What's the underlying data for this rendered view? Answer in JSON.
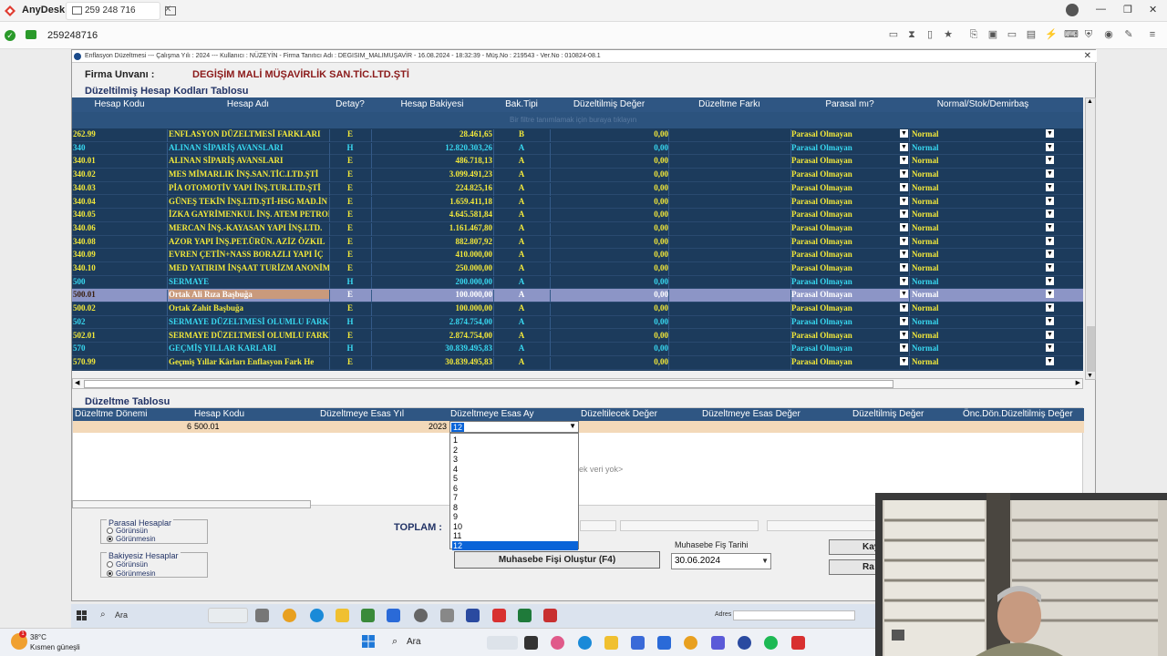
{
  "anydesk": {
    "app_name": "AnyDesk",
    "tab_label": "259 248 716",
    "session_id": "259248716",
    "window_controls": [
      "—",
      "❐",
      "✕"
    ]
  },
  "app": {
    "title": "Enflasyon Düzeltmesi  ---  Çalışma Yılı : 2024  ---  Kullanıcı : NÜZEYİN - Firma Tanıtıcı Adı : DEGISIM_MALIMUŞAVİR - 16.08.2024 - 18:32:39 - Müş.No : 219543 - Ver.No : 010824-08.1",
    "close": "✕",
    "firma_label": "Firma Unvanı :",
    "firma_value": "DEGİŞİM MALİ MÜŞAVİRLİK SAN.TİC.LTD.ŞTİ",
    "section1_title": "Düzeltilmiş Hesap Kodları Tablosu",
    "section2_title": "Düzeltme Tablosu"
  },
  "grid1": {
    "headers": [
      "Hesap Kodu",
      "Hesap Adı",
      "Detay?",
      "Hesap Bakiyesi",
      "Bak.Tipi",
      "Düzeltilmiş Değer",
      "Düzeltme Farkı",
      "Parasal mı?",
      "Normal/Stok/Demirbaş"
    ],
    "filter_hint": "Bir filtre tanımlamak için buraya tıklayın",
    "rows": [
      {
        "kod": "262.99",
        "ad": "ENFLASYON DÜZELTMESİ FARKLARI",
        "detay": "E",
        "bakiye": "28.461,65",
        "tip": "B",
        "duz": "0,00",
        "parasal": "Parasal Olmayan",
        "nsd": "Normal"
      },
      {
        "kod": "340",
        "ad": "ALINAN SİPARİŞ AVANSLARI",
        "detay": "H",
        "bakiye": "12.820.303,26",
        "tip": "A",
        "duz": "0,00",
        "parasal": "Parasal Olmayan",
        "nsd": "Normal"
      },
      {
        "kod": "340.01",
        "ad": "ALINAN SİPARİŞ AVANSLARI",
        "detay": "E",
        "bakiye": "486.718,13",
        "tip": "A",
        "duz": "0,00",
        "parasal": "Parasal Olmayan",
        "nsd": "Normal"
      },
      {
        "kod": "340.02",
        "ad": "MES MİMARLIK İNŞ.SAN.TİC.LTD.ŞTİ",
        "detay": "E",
        "bakiye": "3.099.491,23",
        "tip": "A",
        "duz": "0,00",
        "parasal": "Parasal Olmayan",
        "nsd": "Normal"
      },
      {
        "kod": "340.03",
        "ad": "PİA OTOMOTİV YAPI İNŞ.TUR.LTD.ŞTİ",
        "detay": "E",
        "bakiye": "224.825,16",
        "tip": "A",
        "duz": "0,00",
        "parasal": "Parasal Olmayan",
        "nsd": "Normal"
      },
      {
        "kod": "340.04",
        "ad": "GÜNEŞ TEKİN İNŞ.LTD.ŞTİ-HSG MAD.İN",
        "detay": "E",
        "bakiye": "1.659.411,18",
        "tip": "A",
        "duz": "0,00",
        "parasal": "Parasal Olmayan",
        "nsd": "Normal"
      },
      {
        "kod": "340.05",
        "ad": "İZKA GAYRİMENKUL İNŞ. ATEM PETROL",
        "detay": "E",
        "bakiye": "4.645.581,84",
        "tip": "A",
        "duz": "0,00",
        "parasal": "Parasal Olmayan",
        "nsd": "Normal"
      },
      {
        "kod": "340.06",
        "ad": "MERCAN İNŞ.-KAYASAN YAPI İNŞ.LTD.",
        "detay": "E",
        "bakiye": "1.161.467,80",
        "tip": "A",
        "duz": "0,00",
        "parasal": "Parasal Olmayan",
        "nsd": "Normal"
      },
      {
        "kod": "340.08",
        "ad": "AZOR YAPI İNŞ.PET.ÜRÜN. AZİZ ÖZKIL",
        "detay": "E",
        "bakiye": "882.807,92",
        "tip": "A",
        "duz": "0,00",
        "parasal": "Parasal Olmayan",
        "nsd": "Normal"
      },
      {
        "kod": "340.09",
        "ad": "EVREN ÇETİN+NASS BORAZLI YAPI İÇ",
        "detay": "E",
        "bakiye": "410.000,00",
        "tip": "A",
        "duz": "0,00",
        "parasal": "Parasal Olmayan",
        "nsd": "Normal"
      },
      {
        "kod": "340.10",
        "ad": "MED YATIRIM İNŞAAT TURİZM ANONİM",
        "detay": "E",
        "bakiye": "250.000,00",
        "tip": "A",
        "duz": "0,00",
        "parasal": "Parasal Olmayan",
        "nsd": "Normal"
      },
      {
        "kod": "500",
        "ad": "SERMAYE",
        "detay": "H",
        "bakiye": "200.000,00",
        "tip": "A",
        "duz": "0,00",
        "parasal": "Parasal Olmayan",
        "nsd": "Normal"
      },
      {
        "kod": "500.01",
        "ad": "Ortak Ali Rıza Başbuğa",
        "detay": "E",
        "bakiye": "100.000,00",
        "tip": "A",
        "duz": "0,00",
        "parasal": "Parasal Olmayan",
        "nsd": "Normal",
        "selected": true
      },
      {
        "kod": "500.02",
        "ad": "Ortak Zahit Başbuğa",
        "detay": "E",
        "bakiye": "100.000,00",
        "tip": "A",
        "duz": "0,00",
        "parasal": "Parasal Olmayan",
        "nsd": "Normal"
      },
      {
        "kod": "502",
        "ad": "SERMAYE DÜZELTMESİ OLUMLU FARKL",
        "detay": "H",
        "bakiye": "2.874.754,00",
        "tip": "A",
        "duz": "0,00",
        "parasal": "Parasal Olmayan",
        "nsd": "Normal"
      },
      {
        "kod": "502.01",
        "ad": "SERMAYE DÜZELTMESİ OLUMLU FARKL",
        "detay": "E",
        "bakiye": "2.874.754,00",
        "tip": "A",
        "duz": "0,00",
        "parasal": "Parasal Olmayan",
        "nsd": "Normal"
      },
      {
        "kod": "570",
        "ad": "GEÇMİŞ YILLAR KARLARI",
        "detay": "H",
        "bakiye": "30.839.495,83",
        "tip": "A",
        "duz": "0,00",
        "parasal": "Parasal Olmayan",
        "nsd": "Normal"
      },
      {
        "kod": "570.99",
        "ad": "Geçmiş Yıllar Kârları Enflasyon Fark He",
        "detay": "E",
        "bakiye": "30.839.495,83",
        "tip": "A",
        "duz": "0,00",
        "parasal": "Parasal Olmayan",
        "nsd": "Normal"
      }
    ]
  },
  "grid2": {
    "headers": [
      "Düzeltme Dönemi",
      "Hesap Kodu",
      "Düzeltmeye Esas Yıl",
      "Düzeltmeye Esas Ay",
      "Düzeltilecek Değer",
      "Düzeltmeye Esas Değer",
      "Düzeltilmiş Değer",
      "Önc.Dön.Düzeltilmiş Değer"
    ],
    "row": {
      "donem": "6",
      "kod": "500.01",
      "yil": "2023",
      "ay": "12"
    },
    "empty_text": "ek veri yok>",
    "month_options": [
      "1",
      "2",
      "3",
      "4",
      "5",
      "6",
      "7",
      "8",
      "9",
      "10",
      "11",
      "12"
    ],
    "selected_month": "12"
  },
  "bottom": {
    "group1_title": "Parasal Hesaplar",
    "group1_opt1": "Görünsün",
    "group1_opt2": "Görünmesin",
    "group2_title": "Bakiyesiz Hesaplar",
    "group2_opt1": "Görünsün",
    "group2_opt2": "Görünmesin",
    "toplam_label": "TOPLAM :",
    "fis_button": "Muhasebe Fişi Oluştur (F4)",
    "fis_date_label": "Muhasebe Fiş Tarihi",
    "fis_date_value": "30.06.2024",
    "btn_kay": "Kay",
    "btn_rap": "Ra"
  },
  "remote_taskbar": {
    "search": "Ara",
    "adres_label": "Adres"
  },
  "host_taskbar": {
    "temp": "38°C",
    "weather": "Kısmen güneşli",
    "badge": "1",
    "search": "Ara"
  },
  "colors": {
    "grid_bg": "#1c3b5c",
    "header_bg": "#2f5683",
    "yellow_text": "#f2e83a",
    "cyan_text": "#38d8f0"
  }
}
